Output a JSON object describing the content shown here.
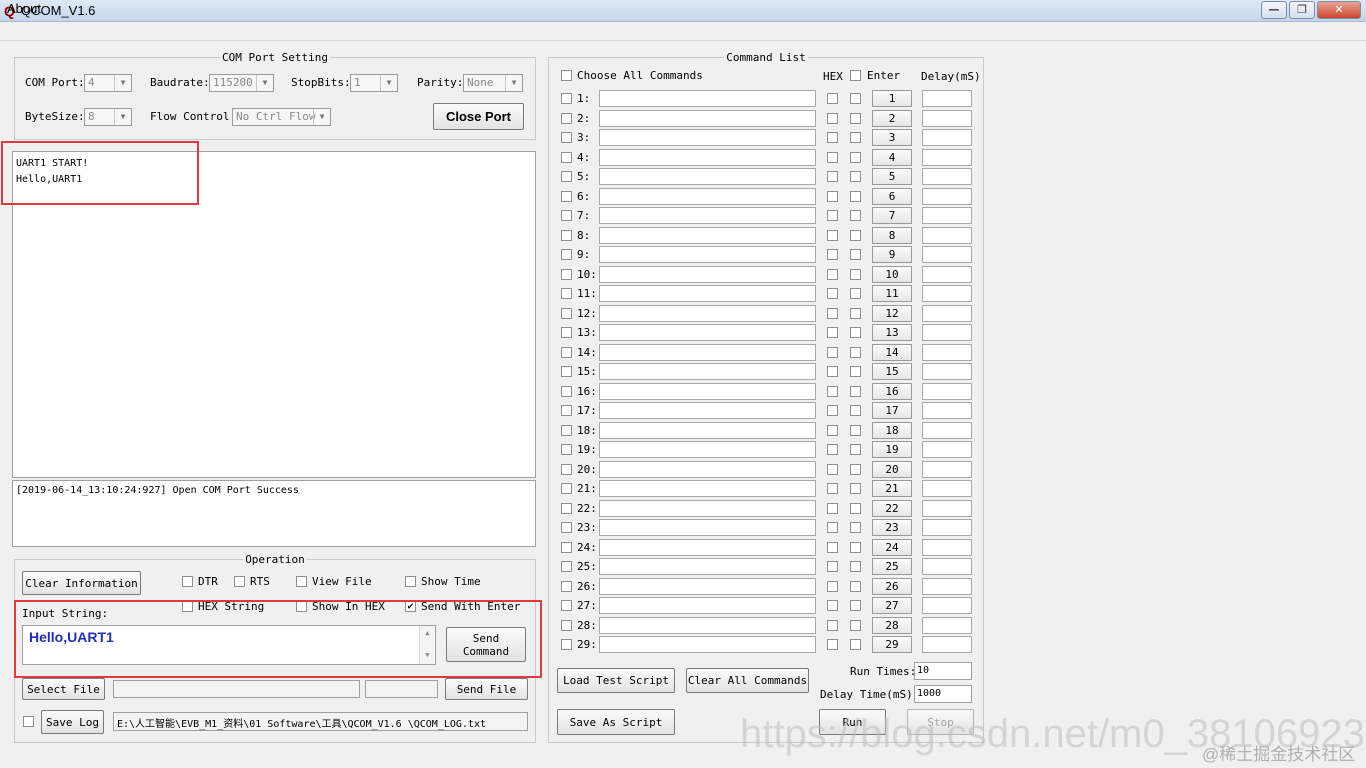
{
  "window": {
    "title": "QCOM_V1.6",
    "icon": "Q",
    "minimize": "—",
    "maximize": "❐",
    "close": "✕"
  },
  "menu": {
    "about": "About"
  },
  "com_port_setting": {
    "legend": "COM Port Setting",
    "com_port_label": "COM Port:",
    "com_port_value": "4",
    "baudrate_label": "Baudrate:",
    "baudrate_value": "115200",
    "stopbits_label": "StopBits:",
    "stopbits_value": "1",
    "parity_label": "Parity:",
    "parity_value": "None",
    "bytesize_label": "ByteSize:",
    "bytesize_value": "8",
    "flow_control_label": "Flow Control:",
    "flow_control_value": "No Ctrl Flow",
    "close_port_label": "Close Port"
  },
  "receive": {
    "lines": [
      "UART1 START!",
      "Hello,UART1"
    ]
  },
  "log": {
    "text": "[2019-06-14_13:10:24:927] Open COM Port Success"
  },
  "operation": {
    "legend": "Operation",
    "clear_information": "Clear Information",
    "dtr": "DTR",
    "rts": "RTS",
    "view_file": "View File",
    "show_time": "Show Time",
    "hex_string": "HEX String",
    "show_in_hex": "Show In HEX",
    "send_with_enter": "Send With Enter",
    "input_string_label": "Input String:",
    "input_value": "Hello,UART1",
    "send_command": "Send Command",
    "select_file": "Select File",
    "send_file": "Send File",
    "save_log": "Save Log",
    "log_path": "E:\\人工智能\\EVB_M1_资料\\01 Software\\工具\\QCOM_V1.6 \\QCOM_LOG.txt"
  },
  "command_list": {
    "legend": "Command List",
    "choose_all": "Choose All Commands",
    "hex_header": "HEX",
    "enter_header": "Enter",
    "delay_header": "Delay(mS)",
    "rows": [
      "1",
      "2",
      "3",
      "4",
      "5",
      "6",
      "7",
      "8",
      "9",
      "10",
      "11",
      "12",
      "13",
      "14",
      "15",
      "16",
      "17",
      "18",
      "19",
      "20",
      "21",
      "22",
      "23",
      "24",
      "25",
      "26",
      "27",
      "28",
      "29"
    ],
    "load_test_script": "Load Test Script",
    "clear_all_commands": "Clear All Commands",
    "save_as_script": "Save As Script",
    "run_times_label": "Run Times:",
    "run_times_value": "10",
    "delay_time_label": "Delay Time(mS):",
    "delay_time_value": "1000",
    "run": "Run",
    "stop": "Stop"
  },
  "watermarks": {
    "main": "https://blog.csdn.net/m0_38106923",
    "corner": "@稀土掘金技术社区"
  },
  "colors": {
    "highlight_box": "#e13a3a",
    "input_text": "#1f2fbf"
  }
}
